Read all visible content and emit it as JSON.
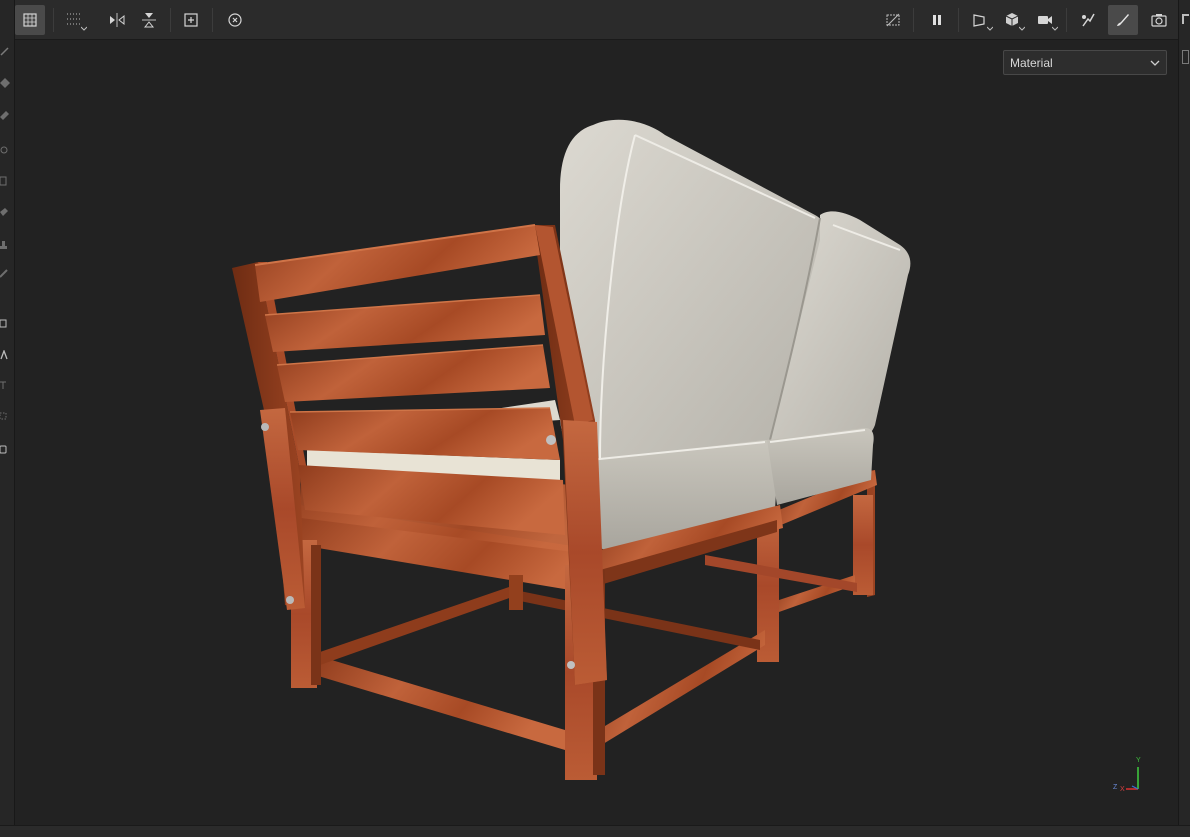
{
  "toolbar": {
    "left_tools": [
      {
        "icon": "select-grid-icon",
        "active": true
      },
      {
        "icon": "dotted-grid-icon",
        "active": false
      },
      {
        "icon": "mirror-horizontal-icon",
        "active": false
      },
      {
        "icon": "mirror-vertical-icon",
        "active": false
      },
      {
        "icon": "add-frame-icon",
        "active": false
      },
      {
        "icon": "reset-view-icon",
        "active": false
      }
    ],
    "right_tools": [
      {
        "icon": "hide-overlay-icon"
      },
      {
        "icon": "pause-icon"
      },
      {
        "icon": "perspective-icon"
      },
      {
        "icon": "cube-icon"
      },
      {
        "icon": "camera-video-icon"
      },
      {
        "icon": "lighting-icon"
      },
      {
        "icon": "paint-brush-icon",
        "active": true
      },
      {
        "icon": "screenshot-camera-icon"
      }
    ]
  },
  "viewport": {
    "render_mode": {
      "selected": "Material"
    },
    "axis_gizmo": {
      "y_label": "Y",
      "z_label": "Z",
      "x_label": "X"
    }
  },
  "colors": {
    "wood": "#b4552e",
    "wood_dark": "#7a3318",
    "cushion": "#cfccc3",
    "cushion_shade": "#9e9b93",
    "background": "#222222"
  }
}
